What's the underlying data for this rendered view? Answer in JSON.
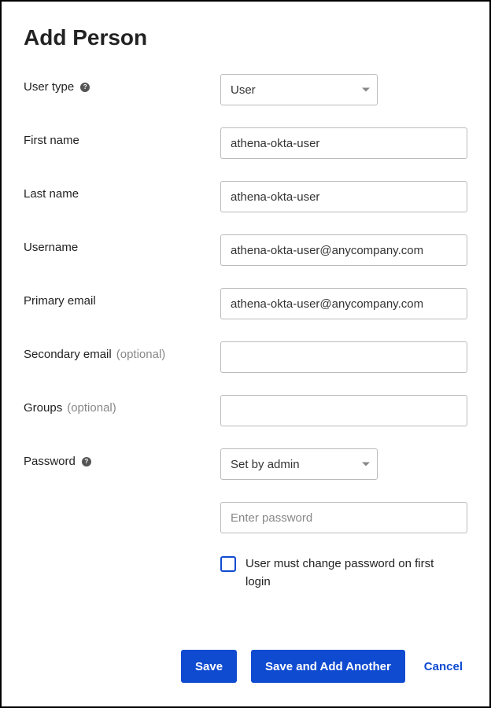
{
  "title": "Add Person",
  "fields": {
    "userType": {
      "label": "User type",
      "value": "User"
    },
    "firstName": {
      "label": "First name",
      "value": "athena-okta-user"
    },
    "lastName": {
      "label": "Last name",
      "value": "athena-okta-user"
    },
    "username": {
      "label": "Username",
      "value": "athena-okta-user@anycompany.com"
    },
    "primaryEmail": {
      "label": "Primary email",
      "value": "athena-okta-user@anycompany.com"
    },
    "secondaryEmail": {
      "label": "Secondary email ",
      "optional": "(optional)",
      "value": ""
    },
    "groups": {
      "label": "Groups ",
      "optional": "(optional)",
      "value": ""
    },
    "password": {
      "label": "Password",
      "selectValue": "Set by admin",
      "placeholder": "Enter password",
      "value": "",
      "changeOnLogin": "User must change password on first login"
    }
  },
  "buttons": {
    "save": "Save",
    "saveAddAnother": "Save and Add Another",
    "cancel": "Cancel"
  }
}
